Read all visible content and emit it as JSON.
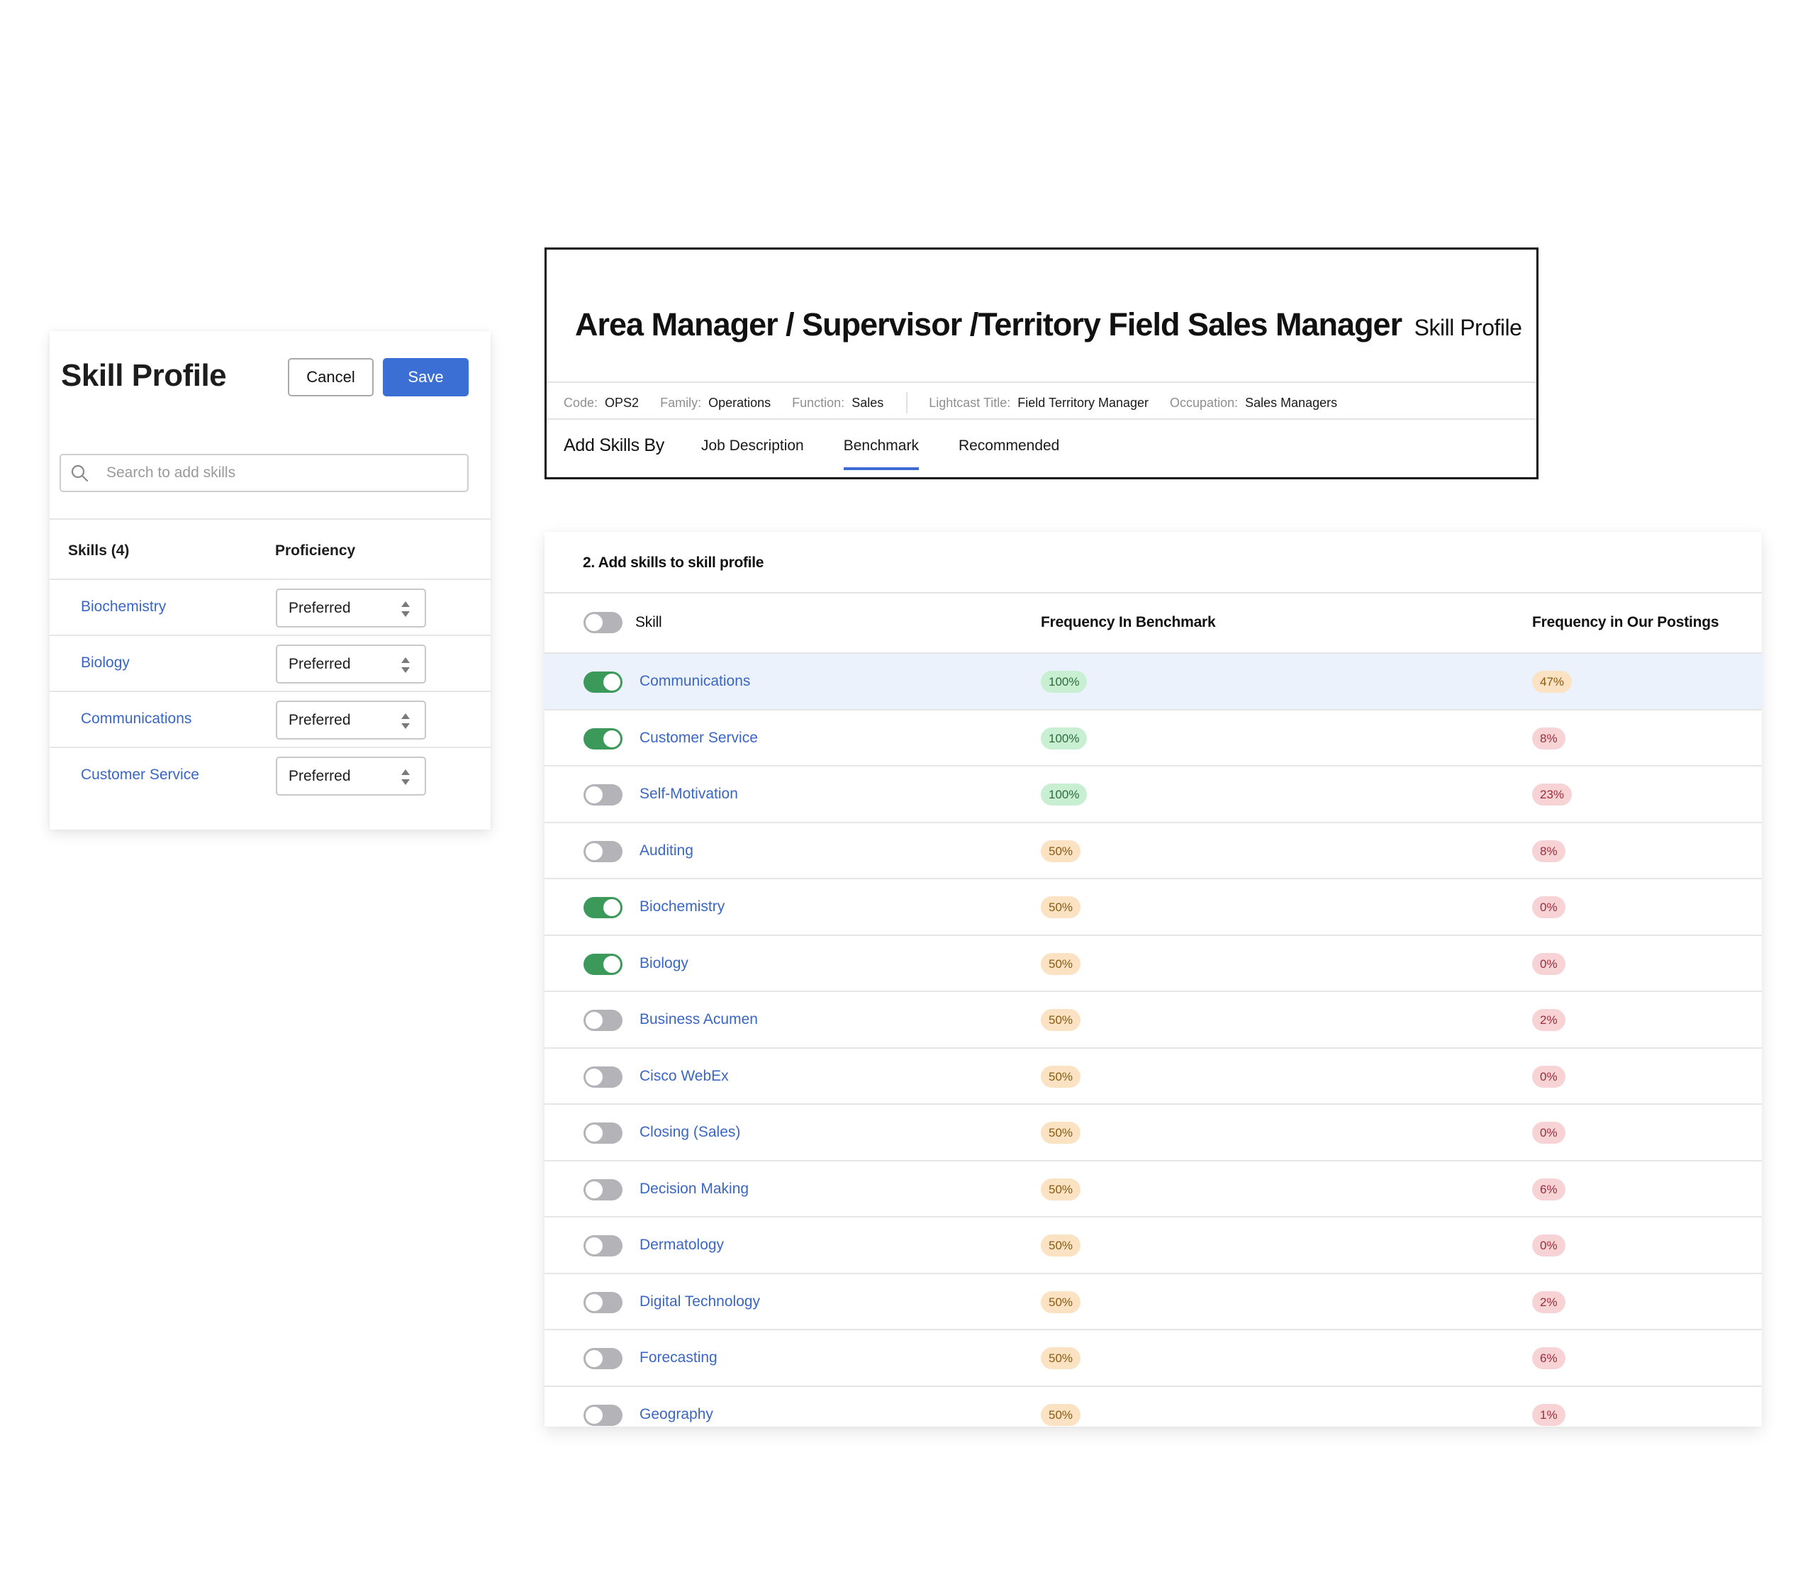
{
  "left_panel": {
    "title": "Skill Profile",
    "cancel_label": "Cancel",
    "save_label": "Save",
    "search_placeholder": "Search to add skills",
    "col_skills": "Skills (4)",
    "col_proficiency": "Proficiency",
    "skills": [
      {
        "name": "Biochemistry",
        "proficiency": "Preferred"
      },
      {
        "name": "Biology",
        "proficiency": "Preferred"
      },
      {
        "name": "Communications",
        "proficiency": "Preferred"
      },
      {
        "name": "Customer Service",
        "proficiency": "Preferred"
      }
    ]
  },
  "header": {
    "title": "Area Manager / Supervisor /Territory Field Sales Manager",
    "subtitle": "Skill Profile",
    "meta": [
      {
        "label": "Code:",
        "value": "OPS2"
      },
      {
        "label": "Family:",
        "value": "Operations"
      },
      {
        "label": "Function:",
        "value": "Sales"
      },
      {
        "label": "Lightcast Title:",
        "value": "Field Territory Manager"
      },
      {
        "label": "Occupation:",
        "value": "Sales Managers"
      }
    ],
    "tabs_label": "Add Skills By",
    "tabs": [
      {
        "label": "Job Description",
        "active": false
      },
      {
        "label": "Benchmark",
        "active": true
      },
      {
        "label": "Recommended",
        "active": false
      }
    ]
  },
  "skills_table": {
    "title": "2. Add skills to skill profile",
    "columns": {
      "skill": "Skill",
      "benchmark": "Frequency In Benchmark",
      "postings": "Frequency in Our Postings"
    },
    "header_toggle_on": false,
    "rows": [
      {
        "skill": "Communications",
        "on": true,
        "benchmark": "100%",
        "postings": "47%",
        "highlight": true
      },
      {
        "skill": "Customer Service",
        "on": true,
        "benchmark": "100%",
        "postings": "8%"
      },
      {
        "skill": "Self-Motivation",
        "on": false,
        "benchmark": "100%",
        "postings": "23%"
      },
      {
        "skill": "Auditing",
        "on": false,
        "benchmark": "50%",
        "postings": "8%"
      },
      {
        "skill": "Biochemistry",
        "on": true,
        "benchmark": "50%",
        "postings": "0%"
      },
      {
        "skill": "Biology",
        "on": true,
        "benchmark": "50%",
        "postings": "0%"
      },
      {
        "skill": "Business Acumen",
        "on": false,
        "benchmark": "50%",
        "postings": "2%"
      },
      {
        "skill": "Cisco WebEx",
        "on": false,
        "benchmark": "50%",
        "postings": "0%"
      },
      {
        "skill": "Closing (Sales)",
        "on": false,
        "benchmark": "50%",
        "postings": "0%"
      },
      {
        "skill": "Decision Making",
        "on": false,
        "benchmark": "50%",
        "postings": "6%"
      },
      {
        "skill": "Dermatology",
        "on": false,
        "benchmark": "50%",
        "postings": "0%"
      },
      {
        "skill": "Digital Technology",
        "on": false,
        "benchmark": "50%",
        "postings": "2%"
      },
      {
        "skill": "Forecasting",
        "on": false,
        "benchmark": "50%",
        "postings": "6%"
      },
      {
        "skill": "Geography",
        "on": false,
        "benchmark": "50%",
        "postings": "1%"
      }
    ]
  },
  "colors": {
    "accent_blue": "#3b6fd4",
    "link_blue": "#3a66c4",
    "toggle_on": "#3b9a5a",
    "toggle_off": "#b3b3b8",
    "badge_green_bg": "#c9efd3",
    "badge_amber_bg": "#fbe2c2",
    "badge_red_bg": "#f7d3d6",
    "row_highlight": "#ebf2fc"
  }
}
